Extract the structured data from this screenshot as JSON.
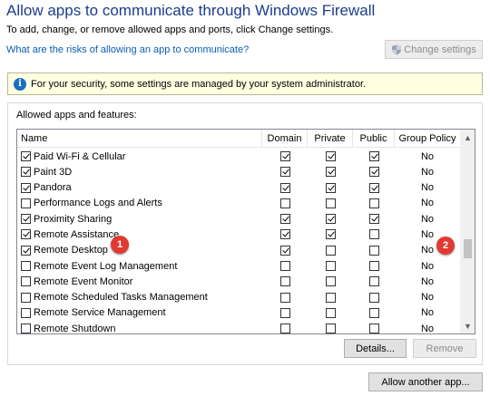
{
  "window": {
    "title": "Allow apps to communicate through Windows Firewall",
    "subtitle": "To add, change, or remove allowed apps and ports, click Change settings.",
    "risk_link": "What are the risks of allowing an app to communicate?",
    "change_settings_label": "Change settings"
  },
  "infobar": {
    "icon": "info-icon",
    "text": "For your security, some settings are managed by your system administrator."
  },
  "panel": {
    "label": "Allowed apps and features:",
    "columns": [
      "Name",
      "Domain",
      "Private",
      "Public",
      "Group Policy"
    ],
    "rows": [
      {
        "name": "Paid Wi-Fi & Cellular",
        "enabled": true,
        "domain": true,
        "private": true,
        "public": true,
        "group_policy": "No"
      },
      {
        "name": "Paint 3D",
        "enabled": true,
        "domain": true,
        "private": true,
        "public": true,
        "group_policy": "No"
      },
      {
        "name": "Pandora",
        "enabled": true,
        "domain": true,
        "private": true,
        "public": true,
        "group_policy": "No"
      },
      {
        "name": "Performance Logs and Alerts",
        "enabled": false,
        "domain": false,
        "private": false,
        "public": false,
        "group_policy": "No"
      },
      {
        "name": "Proximity Sharing",
        "enabled": true,
        "domain": true,
        "private": true,
        "public": true,
        "group_policy": "No"
      },
      {
        "name": "Remote Assistance",
        "enabled": true,
        "domain": true,
        "private": true,
        "public": false,
        "group_policy": "No"
      },
      {
        "name": "Remote Desktop",
        "enabled": true,
        "domain": true,
        "private": false,
        "public": false,
        "group_policy": "No"
      },
      {
        "name": "Remote Event Log Management",
        "enabled": false,
        "domain": false,
        "private": false,
        "public": false,
        "group_policy": "No"
      },
      {
        "name": "Remote Event Monitor",
        "enabled": false,
        "domain": false,
        "private": false,
        "public": false,
        "group_policy": "No"
      },
      {
        "name": "Remote Scheduled Tasks Management",
        "enabled": false,
        "domain": false,
        "private": false,
        "public": false,
        "group_policy": "No"
      },
      {
        "name": "Remote Service Management",
        "enabled": false,
        "domain": false,
        "private": false,
        "public": false,
        "group_policy": "No"
      },
      {
        "name": "Remote Shutdown",
        "enabled": false,
        "domain": false,
        "private": false,
        "public": false,
        "group_policy": "No"
      }
    ],
    "details_label": "Details...",
    "remove_label": "Remove"
  },
  "allow_another_label": "Allow another app...",
  "markers": [
    "1",
    "2"
  ],
  "colors": {
    "title": "#1e3c8c",
    "link": "#0a5cb5",
    "infobar_bg": "#ffffe1",
    "marker": "#e03a33"
  }
}
